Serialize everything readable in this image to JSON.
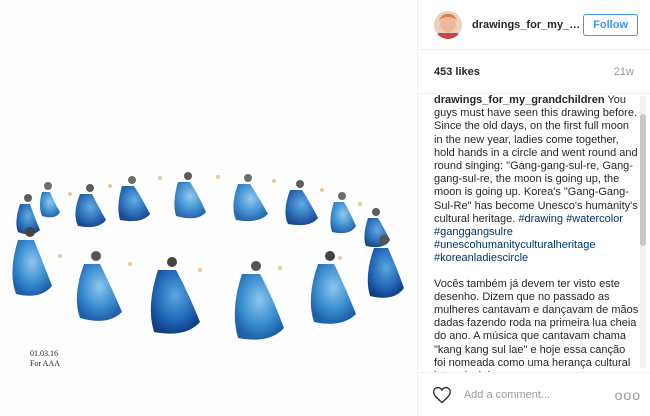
{
  "post": {
    "username": "drawings_for_my_grandchildren",
    "follow_label": "Follow",
    "likes": "453 likes",
    "time": "21w"
  },
  "artwork": {
    "signature_line1": "01.03.16",
    "signature_line2": "For AAA",
    "accent_color": "#3b8fd1"
  },
  "caption": {
    "username": "drawings_for_my_grandchildren",
    "text": " You guys must have seen this drawing before. Since the old days, on the first full moon in the new year, ladies come together, hold hands in a circle and went round and round singing: \"Gang-gang-sul-re, Gang-gang-sul-re, the moon is going up, the moon is going up. Korea's \"Gang-Gang-Sul-Re\" has become Unesco's humanity's cultural heritage.",
    "hashtags": [
      "#drawing",
      "#watercolor",
      "#ganggangsulre",
      "#unescohumanityculturalheritage",
      "#koreanladiescircle"
    ],
    "text_pt": "Vocês também já devem ter visto este desenho. Dizem que no passado as mulheres cantavam e dançavam de mãos dadas fazendo roda na primeira lua cheia do ano. A música que cantavam chama \"kang kang sul lae\" e hoje essa canção foi nomeada como uma herança cultural intangível da"
  },
  "comment": {
    "placeholder": "Add a comment...",
    "more_label": "ooo"
  },
  "icons": {
    "avatar": "avatar-photo",
    "heart": "heart-outline-icon",
    "more": "more-options-icon"
  },
  "colors": {
    "follow_blue": "#3897f0",
    "hashtag": "#003569",
    "muted": "#999999"
  }
}
